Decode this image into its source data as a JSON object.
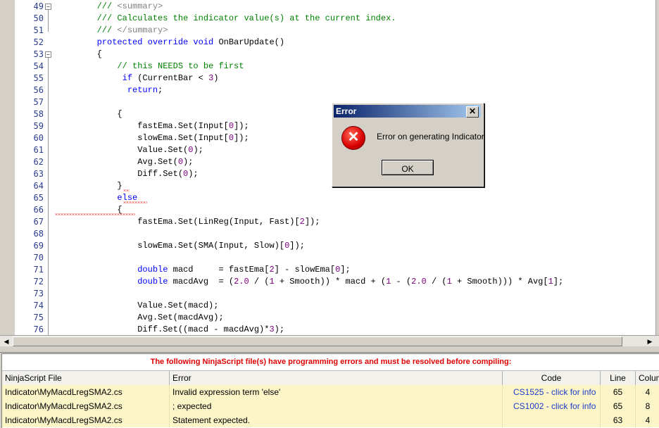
{
  "colors": {
    "comment": "#008000",
    "keyword": "#0000ff",
    "number": "#800080",
    "error_text": "#e00000",
    "link": "#1b3ccc",
    "error_row": "#fbf5c8"
  },
  "editor": {
    "lines": [
      {
        "n": "49",
        "fold": "minus",
        "parts": [
          {
            "t": "        /// <summary>",
            "c": "comment-doc"
          }
        ]
      },
      {
        "n": "50",
        "parts": [
          {
            "t": "        /// Calculates the indicator value(s) at the current index.",
            "c": "comment"
          }
        ]
      },
      {
        "n": "51",
        "parts": [
          {
            "t": "        /// </summary>",
            "c": "comment-doc"
          }
        ]
      },
      {
        "n": "52",
        "parts": [
          {
            "t": "        ",
            "c": ""
          },
          {
            "t": "protected override void",
            "c": "keyword"
          },
          {
            "t": " OnBarUpdate()",
            "c": ""
          }
        ]
      },
      {
        "n": "53",
        "fold": "minus",
        "parts": [
          {
            "t": "        {",
            "c": ""
          }
        ]
      },
      {
        "n": "54",
        "parts": [
          {
            "t": "            // this NEEDS to be first",
            "c": "comment"
          }
        ]
      },
      {
        "n": "55",
        "parts": [
          {
            "t": "             ",
            "c": ""
          },
          {
            "t": "if",
            "c": "keyword"
          },
          {
            "t": " (CurrentBar < ",
            "c": ""
          },
          {
            "t": "3",
            "c": "number"
          },
          {
            "t": ")",
            "c": ""
          }
        ]
      },
      {
        "n": "56",
        "parts": [
          {
            "t": "              ",
            "c": ""
          },
          {
            "t": "return",
            "c": "keyword"
          },
          {
            "t": ";",
            "c": ""
          }
        ]
      },
      {
        "n": "57",
        "parts": [
          {
            "t": "",
            "c": ""
          }
        ]
      },
      {
        "n": "58",
        "parts": [
          {
            "t": "            {",
            "c": ""
          }
        ]
      },
      {
        "n": "59",
        "parts": [
          {
            "t": "                fastEma.Set(Input[",
            "c": ""
          },
          {
            "t": "0",
            "c": "number"
          },
          {
            "t": "]);",
            "c": ""
          }
        ]
      },
      {
        "n": "60",
        "parts": [
          {
            "t": "                slowEma.Set(Input[",
            "c": ""
          },
          {
            "t": "0",
            "c": "number"
          },
          {
            "t": "]);",
            "c": ""
          }
        ]
      },
      {
        "n": "61",
        "parts": [
          {
            "t": "                Value.Set(",
            "c": ""
          },
          {
            "t": "0",
            "c": "number"
          },
          {
            "t": ");",
            "c": ""
          }
        ]
      },
      {
        "n": "62",
        "parts": [
          {
            "t": "                Avg.Set(",
            "c": ""
          },
          {
            "t": "0",
            "c": "number"
          },
          {
            "t": ");",
            "c": ""
          }
        ]
      },
      {
        "n": "63",
        "parts": [
          {
            "t": "                Diff.Set(",
            "c": ""
          },
          {
            "t": "0",
            "c": "number"
          },
          {
            "t": ");",
            "c": ""
          }
        ]
      },
      {
        "n": "64",
        "parts": [
          {
            "t": "            }",
            "c": ""
          }
        ]
      },
      {
        "n": "65",
        "parts": [
          {
            "t": "            ",
            "c": ""
          },
          {
            "t": "else",
            "c": "keyword"
          }
        ]
      },
      {
        "n": "66",
        "parts": [
          {
            "t": "            {",
            "c": ""
          }
        ]
      },
      {
        "n": "67",
        "parts": [
          {
            "t": "                fastEma.Set(LinReg(Input, Fast)[",
            "c": ""
          },
          {
            "t": "2",
            "c": "number"
          },
          {
            "t": "]);",
            "c": ""
          }
        ]
      },
      {
        "n": "68",
        "parts": [
          {
            "t": "",
            "c": ""
          }
        ]
      },
      {
        "n": "69",
        "parts": [
          {
            "t": "                slowEma.Set(SMA(Input, Slow)[",
            "c": ""
          },
          {
            "t": "0",
            "c": "number"
          },
          {
            "t": "]);",
            "c": ""
          }
        ]
      },
      {
        "n": "70",
        "parts": [
          {
            "t": "",
            "c": ""
          }
        ]
      },
      {
        "n": "71",
        "parts": [
          {
            "t": "                ",
            "c": ""
          },
          {
            "t": "double",
            "c": "keyword"
          },
          {
            "t": " macd     = fastEma[",
            "c": ""
          },
          {
            "t": "2",
            "c": "number"
          },
          {
            "t": "] - slowEma[",
            "c": ""
          },
          {
            "t": "0",
            "c": "number"
          },
          {
            "t": "];",
            "c": ""
          }
        ]
      },
      {
        "n": "72",
        "parts": [
          {
            "t": "                ",
            "c": ""
          },
          {
            "t": "double",
            "c": "keyword"
          },
          {
            "t": " macdAvg  = (",
            "c": ""
          },
          {
            "t": "2.0",
            "c": "number"
          },
          {
            "t": " / (",
            "c": ""
          },
          {
            "t": "1",
            "c": "number"
          },
          {
            "t": " + Smooth)) * macd + (",
            "c": ""
          },
          {
            "t": "1",
            "c": "number"
          },
          {
            "t": " - (",
            "c": ""
          },
          {
            "t": "2.0",
            "c": "number"
          },
          {
            "t": " / (",
            "c": ""
          },
          {
            "t": "1",
            "c": "number"
          },
          {
            "t": " + Smooth))) * Avg[",
            "c": ""
          },
          {
            "t": "1",
            "c": "number"
          },
          {
            "t": "];",
            "c": ""
          }
        ]
      },
      {
        "n": "73",
        "parts": [
          {
            "t": "",
            "c": ""
          }
        ]
      },
      {
        "n": "74",
        "parts": [
          {
            "t": "                Value.Set(macd);",
            "c": ""
          }
        ]
      },
      {
        "n": "75",
        "parts": [
          {
            "t": "                Avg.Set(macdAvg);",
            "c": ""
          }
        ]
      },
      {
        "n": "76",
        "parts": [
          {
            "t": "                Diff.Set((macd - macdAvg)*",
            "c": ""
          },
          {
            "t": "3",
            "c": "number"
          },
          {
            "t": ");",
            "c": ""
          }
        ]
      }
    ]
  },
  "dialog": {
    "title": "Error",
    "close": "✕",
    "icon": "error-x-icon",
    "message": "Error on generating Indicator",
    "ok_label": "OK"
  },
  "errors": {
    "title": "The following NinjaScript file(s) have programming errors and must be resolved before compiling:",
    "columns": [
      "NinjaScript File",
      "Error",
      "Code",
      "Line",
      "Colum"
    ],
    "rows": [
      {
        "file": "Indicator\\MyMacdLregSMA2.cs",
        "error": "Invalid expression term 'else'",
        "code": "CS1525 - click for info",
        "line": "65",
        "col": "4"
      },
      {
        "file": "Indicator\\MyMacdLregSMA2.cs",
        "error": "; expected",
        "code": "CS1002 - click for info",
        "line": "65",
        "col": "8"
      },
      {
        "file": "Indicator\\MyMacdLregSMA2.cs",
        "error": "Statement expected.",
        "code": "",
        "line": "63",
        "col": "4"
      }
    ]
  }
}
